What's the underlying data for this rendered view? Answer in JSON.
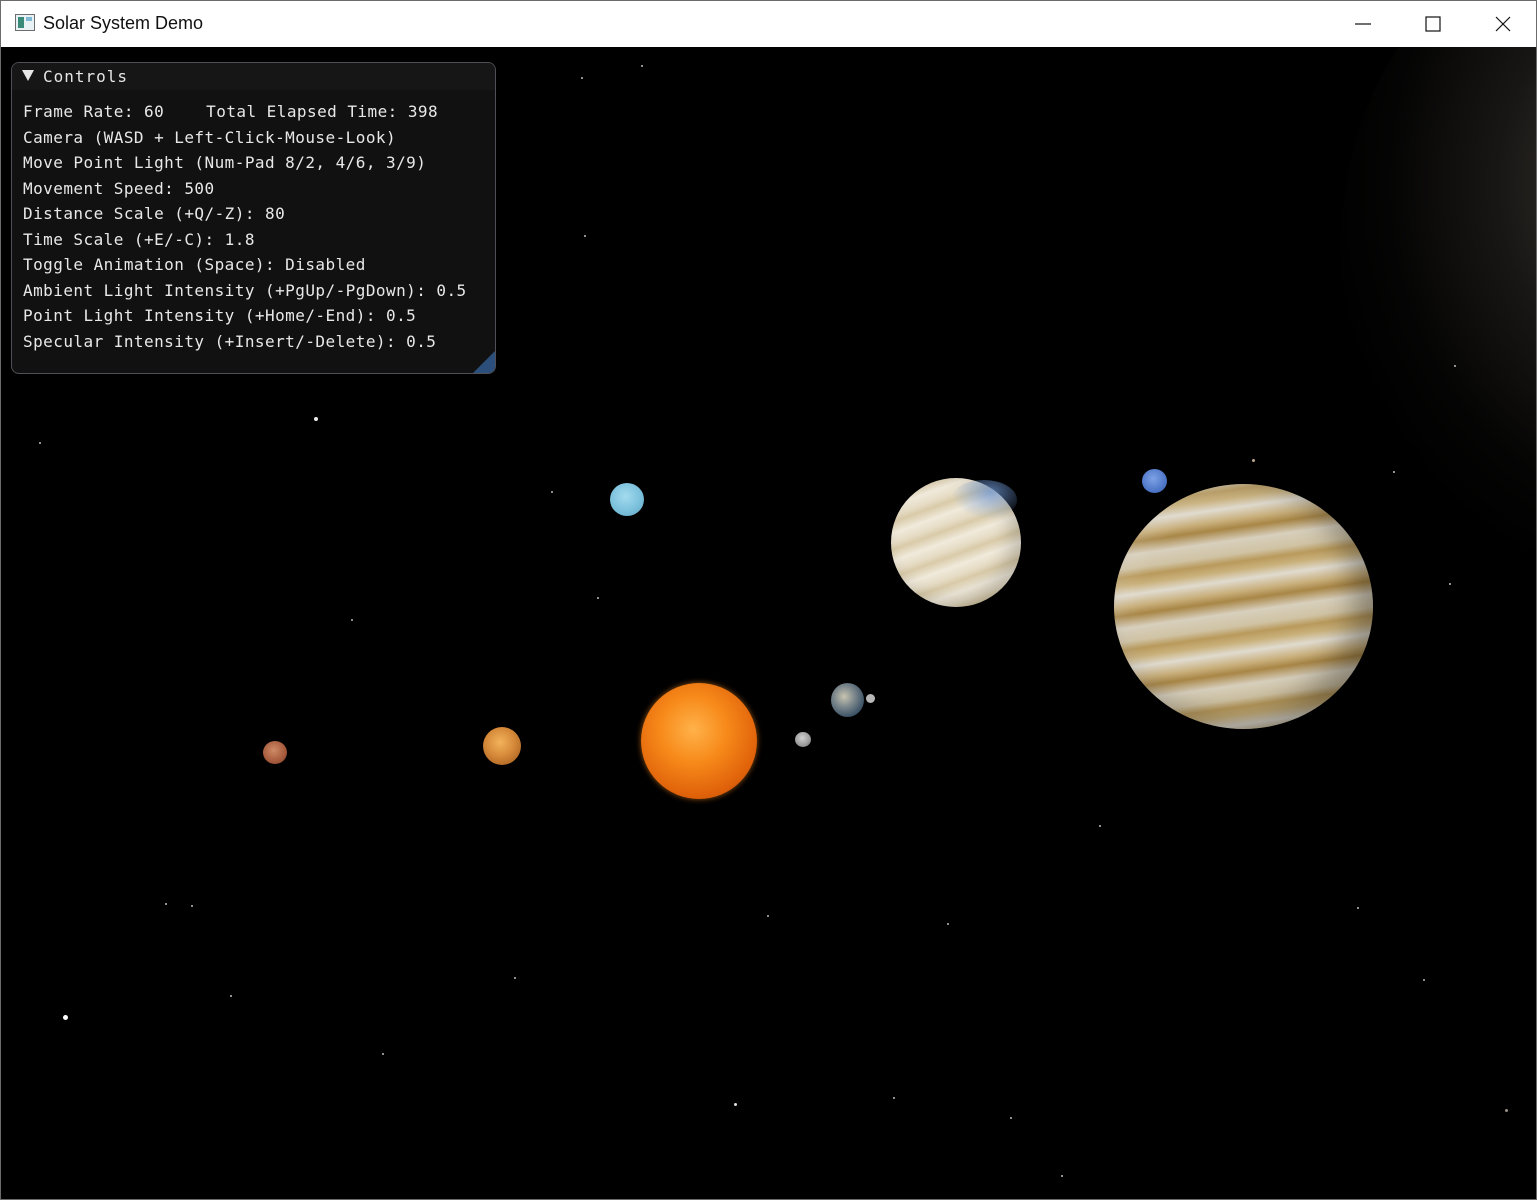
{
  "window": {
    "title": "Solar System Demo"
  },
  "controls_panel": {
    "title": "Controls",
    "frame_rate_label": "Frame Rate: 60",
    "elapsed_label": "Total Elapsed Time: 398",
    "camera_label": "Camera (WASD + Left-Click-Mouse-Look)",
    "point_light_move_label": "Move Point Light (Num-Pad 8/2, 4/6, 3/9)",
    "movement_speed_label": "Movement Speed: 500",
    "distance_scale_label": "Distance Scale (+Q/-Z): 80",
    "time_scale_label": "Time Scale (+E/-C): 1.8",
    "toggle_animation_label": "Toggle Animation (Space): Disabled",
    "ambient_light_label": "Ambient Light Intensity (+PgUp/-PgDown): 0.5",
    "point_light_intensity_label": "Point Light Intensity (+Home/-End): 0.5",
    "specular_intensity_label": "Specular Intensity (+Insert/-Delete): 0.5"
  },
  "colors": {
    "sun": "#f07a12",
    "jupiter": "#c9b48a",
    "saturn": "#e6dcc8",
    "uranus": "#7fc2dc",
    "neptune": "#4f78c8",
    "earth": "#4a6478",
    "mars": "#a55a3c",
    "venus": "#d68a3a",
    "mercury": "#9a9a9a"
  }
}
